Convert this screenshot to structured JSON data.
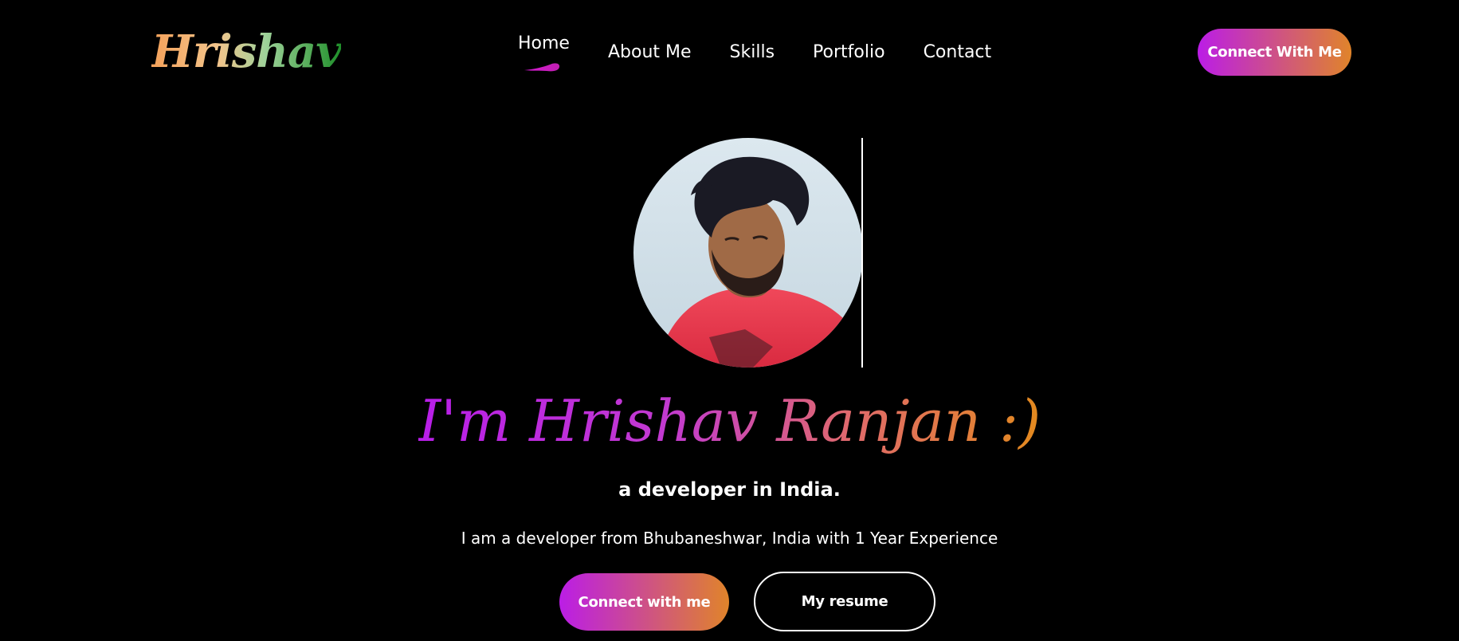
{
  "header": {
    "logo_text": "Hrishav",
    "nav": [
      {
        "label": "Home",
        "active": true
      },
      {
        "label": "About Me",
        "active": false
      },
      {
        "label": "Skills",
        "active": false
      },
      {
        "label": "Portfolio",
        "active": false
      },
      {
        "label": "Contact",
        "active": false
      }
    ],
    "cta_label": "Connect With Me"
  },
  "hero": {
    "avatar_icon": "profile-photo",
    "title": "I'm Hrishav Ranjan :)",
    "subtitle": "a developer in India.",
    "description": "I am a developer from Bhubaneshwar, India with 1 Year Experience",
    "primary_button": "Connect with me",
    "secondary_button": "My resume"
  },
  "colors": {
    "background": "#000000",
    "text": "#ffffff",
    "gradient_start": "#bb1de6",
    "gradient_end": "#e0842a",
    "logo_start": "#f4a15a",
    "logo_end": "#1f8f2a"
  }
}
